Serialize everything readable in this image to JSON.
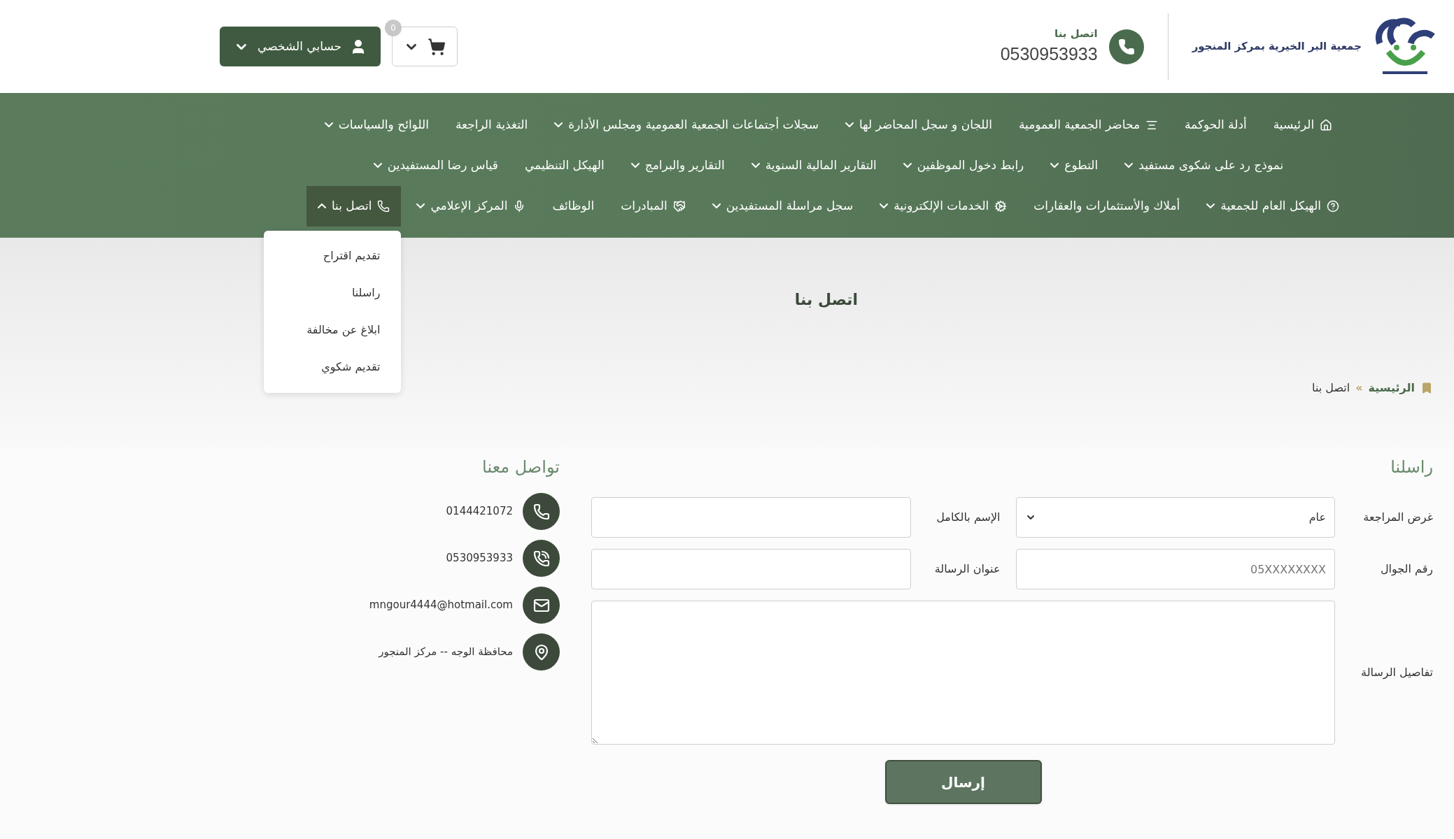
{
  "header": {
    "org_name": "جمعية البر الخيرية بمركز المنجور",
    "contact_label": "اتصل بنا",
    "contact_phone": "0530953933",
    "account_button": "حسابي الشخصي",
    "cart_count": "0"
  },
  "nav": {
    "groups": [
      {
        "items": [
          {
            "label": "الرئيسية",
            "kind": "home",
            "dropdown": false,
            "selected": false
          },
          {
            "label": "أدلة الحوكمة",
            "kind": "plain",
            "dropdown": false,
            "selected": false
          },
          {
            "label": "محاضر الجمعية العمومية",
            "kind": "list",
            "dropdown": false,
            "selected": false
          },
          {
            "label": "اللجان و سجل المحاضر لها",
            "kind": "plain",
            "dropdown": true,
            "expanded": false,
            "selected": false
          },
          {
            "label": "سجلات أجتماعات الجمعية العمومية ومجلس الأدارة",
            "kind": "plain",
            "dropdown": true,
            "expanded": false,
            "selected": false
          },
          {
            "label": "التغذية الراجعة",
            "kind": "plain",
            "dropdown": false,
            "selected": false
          },
          {
            "label": "اللوائح والسياسات",
            "kind": "plain",
            "dropdown": true,
            "expanded": false,
            "selected": false
          }
        ]
      },
      {
        "items": [
          {
            "label": "نموذج رد على شكوى مستفيد",
            "kind": "plain",
            "dropdown": true,
            "expanded": false,
            "selected": false
          },
          {
            "label": "التطوع",
            "kind": "plain",
            "dropdown": true,
            "expanded": false,
            "selected": false
          },
          {
            "label": "رابط دخول الموظفين",
            "kind": "plain",
            "dropdown": true,
            "expanded": false,
            "selected": false
          },
          {
            "label": "التقارير المالية السنوية",
            "kind": "plain",
            "dropdown": true,
            "expanded": false,
            "selected": false
          },
          {
            "label": "التقارير والبرامج",
            "kind": "plain",
            "dropdown": true,
            "expanded": false,
            "selected": false
          },
          {
            "label": "الهيكل التنظيمي",
            "kind": "plain",
            "dropdown": false,
            "selected": false
          },
          {
            "label": "قياس رضا المستفيدين",
            "kind": "plain",
            "dropdown": true,
            "expanded": false,
            "selected": false
          }
        ]
      },
      {
        "items": [
          {
            "label": "الهيكل العام للجمعية",
            "kind": "question",
            "dropdown": true,
            "expanded": false,
            "selected": false
          },
          {
            "label": "أملاك والأستثمارات والعقارات",
            "kind": "plain",
            "dropdown": false,
            "selected": false
          },
          {
            "label": "الخدمات الإلكترونية",
            "kind": "gears",
            "dropdown": true,
            "expanded": false,
            "selected": false
          },
          {
            "label": "سجل مراسلة المستفيدين",
            "kind": "plain",
            "dropdown": true,
            "expanded": false,
            "selected": false
          },
          {
            "label": "المبادرات",
            "kind": "handshake",
            "dropdown": false,
            "selected": false
          },
          {
            "label": "الوظائف",
            "kind": "plain",
            "dropdown": false,
            "selected": false
          },
          {
            "label": "المركز الإعلامي",
            "kind": "mic",
            "dropdown": true,
            "expanded": false,
            "selected": false
          },
          {
            "label": "اتصل بنا",
            "kind": "phone",
            "dropdown": true,
            "expanded": true,
            "selected": true,
            "submenu": [
              "تقديم اقتراح",
              "راسلنا",
              "ابلاغ عن مخالفة",
              "تقديم شكوي"
            ]
          }
        ]
      }
    ]
  },
  "page_title": "اتصل بنا",
  "breadcrumb": {
    "home": "الرئيسية",
    "separator": "»",
    "current": "اتصل بنا"
  },
  "form": {
    "title": "راسلنا",
    "purpose": {
      "label": "غرض المراجعة",
      "value": "عام"
    },
    "full_name": {
      "label": "الإسم بالكامل"
    },
    "mobile": {
      "label": "رقم الجوال",
      "placeholder": "05XXXXXXXX"
    },
    "subject": {
      "label": "عنوان الرسالة"
    },
    "details": {
      "label": "تفاصيل الرسالة"
    },
    "submit": "إرسال"
  },
  "contact": {
    "title": "تواصل معنا",
    "items": [
      {
        "kind": "landline",
        "text": "0144421072"
      },
      {
        "kind": "mobile",
        "text": "0530953933"
      },
      {
        "kind": "email",
        "text": "mngour4444@hotmail.com"
      },
      {
        "kind": "location",
        "text": "محافظة الوجه -- مركز المنجور"
      }
    ]
  }
}
